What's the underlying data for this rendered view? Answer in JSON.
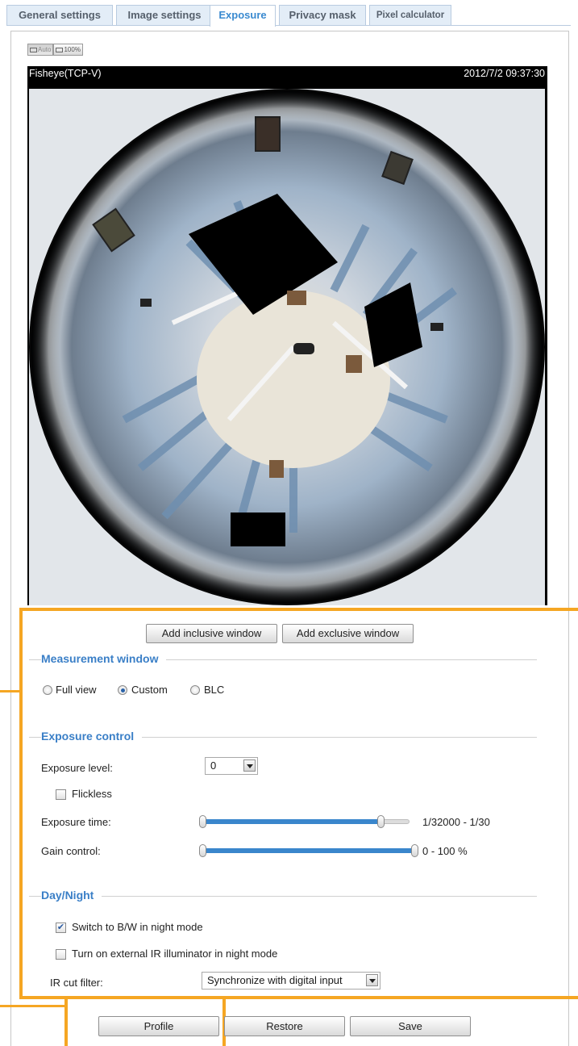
{
  "tabs": [
    {
      "label": "General settings"
    },
    {
      "label": "Image settings"
    },
    {
      "label": "Exposure"
    },
    {
      "label": "Privacy mask"
    },
    {
      "label": "Pixel calculator"
    }
  ],
  "view_buttons": {
    "auto": "Auto",
    "full": "100%"
  },
  "video": {
    "stream_name": "Fisheye(TCP-V)",
    "timestamp": "2012/7/2 09:37:30"
  },
  "window_buttons": {
    "inclusive": "Add inclusive window",
    "exclusive": "Add exclusive window"
  },
  "measurement": {
    "title": "Measurement window",
    "options": [
      "Full view",
      "Custom",
      "BLC"
    ],
    "selected": "Custom"
  },
  "exposure_control": {
    "title": "Exposure control",
    "level_label": "Exposure level:",
    "level_value": "0",
    "flickless_label": "Flickless",
    "flickless_checked": false,
    "time_label": "Exposure time:",
    "time_range": "1/32000 - 1/30",
    "time_slider_fraction": 0.84,
    "gain_label": "Gain control:",
    "gain_range": "0 - 100 %",
    "gain_slider_fraction": 1.0
  },
  "day_night": {
    "title": "Day/Night",
    "bw_label": "Switch to B/W in night mode",
    "bw_checked": true,
    "ir_label": "Turn on external IR illuminator in night mode",
    "ir_checked": false,
    "ir_cut_label": "IR cut filter:",
    "ir_cut_value": "Synchronize with digital input"
  },
  "footer_buttons": {
    "profile": "Profile",
    "restore": "Restore",
    "save": "Save"
  },
  "colors": {
    "accent": "#3a7fc7",
    "callout": "#f5a623",
    "slider_fill": "#3a86cc"
  }
}
